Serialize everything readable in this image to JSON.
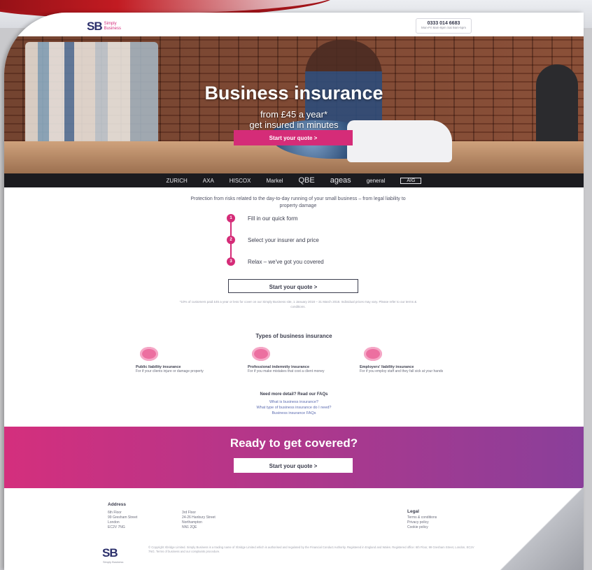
{
  "header": {
    "logo_mark": "SB",
    "logo_line1": "Simply",
    "logo_line2": "Business",
    "phone": "0333 014 6683",
    "phone_hours": "Mon-Fri 8am-8pm Sat 9am-5pm"
  },
  "hero": {
    "title": "Business insurance",
    "subtitle1": "from £45 a year*",
    "subtitle2": "get insured in minutes",
    "cta": "Start your quote >"
  },
  "partners": [
    "ZURICH",
    "AXA",
    "HISCOX",
    "Markel",
    "QBE",
    "ageas",
    "general",
    "AIG"
  ],
  "intro": "Protection from risks related to the day-to-day running of your small business – from legal liability to property damage",
  "steps": [
    {
      "num": "1",
      "text": "Fill in our quick form"
    },
    {
      "num": "2",
      "text": "Select your insurer and price"
    },
    {
      "num": "3",
      "text": "Relax – we've got you covered"
    }
  ],
  "steps_cta": "Start your quote >",
  "disclaimer": "*10% of customers paid £45 a year or less for cover on our Simply Business site, 1 January 2018 – 31 March 2018. Individual prices may vary. Please refer to our terms & conditions.",
  "types": {
    "title": "Types of business insurance",
    "items": [
      {
        "name": "Public liability insurance",
        "desc": "For if your clients injure or damage property"
      },
      {
        "name": "Professional indemnity insurance",
        "desc": "For if you make mistakes that cost a client money"
      },
      {
        "name": "Employers' liability insurance",
        "desc": "For if you employ staff and they fall sick at your hands"
      }
    ]
  },
  "help": {
    "title": "Need more detail? Read our FAQs",
    "links": [
      "What is business insurance?",
      "What type of business insurance do I need?",
      "Business insurance FAQs"
    ]
  },
  "ready": {
    "title": "Ready to get covered?",
    "cta": "Start your quote >"
  },
  "footer": {
    "address_title": "Address",
    "address1": [
      "6th Floor",
      "99 Gresham Street",
      "London",
      "EC2V 7NG"
    ],
    "address2": [
      "3rd Floor",
      "24-26 Hanbury Street",
      "Northampton",
      "NN1 2QE"
    ],
    "legal_title": "Legal",
    "legal_links": [
      "Terms & conditions",
      "Privacy policy",
      "Cookie policy"
    ],
    "logo_sub": "Simply Business",
    "legal_text": "© Copyright Xbridge Limited. Simply Business is a trading name of Xbridge Limited which is authorised and regulated by the Financial Conduct Authority. Registered in England and Wales. Registered office: 6th Floor, 99 Gresham Street, London, EC2V 7NG. Terms of business and our complaints procedure."
  }
}
